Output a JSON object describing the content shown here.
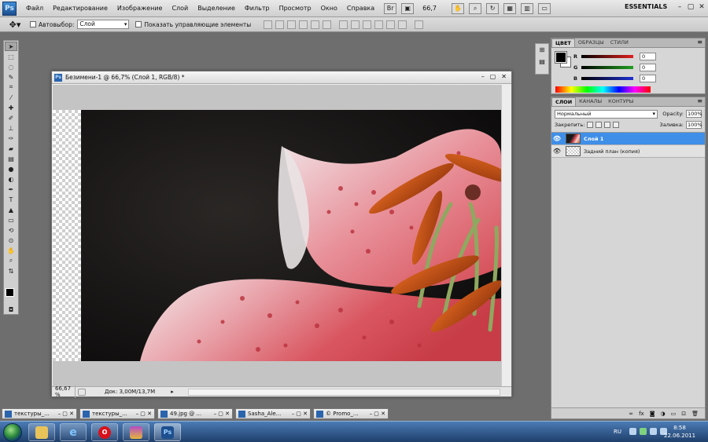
{
  "app": {
    "logo": "Ps",
    "menu": [
      "Файл",
      "Редактирование",
      "Изображение",
      "Слой",
      "Выделение",
      "Фильтр",
      "Просмотр",
      "Окно",
      "Справка"
    ],
    "zoom": "66,7",
    "workspace": "ESSENTIALS"
  },
  "options": {
    "autoselect_label": "Автовыбор:",
    "autoselect_value": "Слой",
    "show_controls_label": "Показать управляющие элементы"
  },
  "document": {
    "title": "Безимени-1 @ 66,7% (Слой 1, RGB/8) *",
    "zoom": "66,67 %",
    "doc_info": "Док: 3,00M/13,7M"
  },
  "color_panel": {
    "tabs": [
      "ЦВЕТ",
      "ОБРАЗЦЫ",
      "СТИЛИ"
    ],
    "channels": [
      {
        "label": "R",
        "value": "0",
        "color": "#e02020"
      },
      {
        "label": "G",
        "value": "0",
        "color": "#20a020"
      },
      {
        "label": "B",
        "value": "0",
        "color": "#2030d0"
      }
    ]
  },
  "layers_panel": {
    "tabs": [
      "СЛОИ",
      "КАНАЛЫ",
      "КОНТУРЫ"
    ],
    "blend_mode": "Нормальный",
    "opacity_label": "Opacity:",
    "opacity_value": "100%",
    "lock_label": "Закрепить:",
    "fill_label": "Заливка:",
    "fill_value": "100%",
    "layers": [
      {
        "name": "Слой 1",
        "selected": true
      },
      {
        "name": "Задний план (копия)",
        "selected": false
      }
    ]
  },
  "minimized_docs": [
    "текстуры_...",
    "текстуры_...",
    "49.jpg @ ...",
    "Sasha_Ale...",
    "© Promo_..."
  ],
  "taskbar": {
    "lang": "RU",
    "time": "8:58",
    "date": "22.06.2011"
  }
}
